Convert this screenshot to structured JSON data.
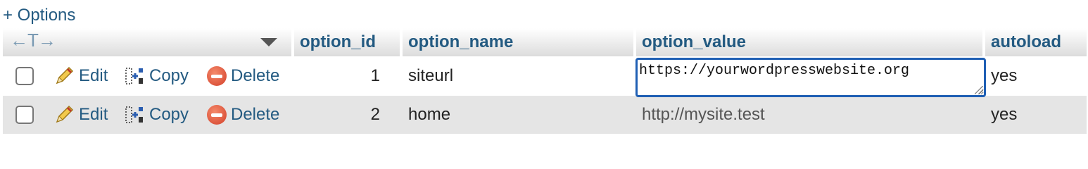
{
  "options_link": "+ Options",
  "header": {
    "arrows": "←T→",
    "columns": [
      "option_id",
      "option_name",
      "option_value",
      "autoload"
    ]
  },
  "actions": {
    "edit": "Edit",
    "copy": "Copy",
    "delete": "Delete"
  },
  "rows": [
    {
      "option_id": "1",
      "option_name": "siteurl",
      "option_value": "https://yourwordpresswebsite.org",
      "autoload": "yes",
      "editing": true
    },
    {
      "option_id": "2",
      "option_name": "home",
      "option_value": "http://mysite.test",
      "autoload": "yes",
      "editing": false
    }
  ],
  "colors": {
    "link": "#235a81",
    "row_alt": "#e5e5e5",
    "edit_border": "#1f5fb4"
  },
  "icons": [
    "pencil-icon",
    "copy-icon",
    "delete-icon",
    "sort-arrow-icon",
    "checkbox"
  ]
}
